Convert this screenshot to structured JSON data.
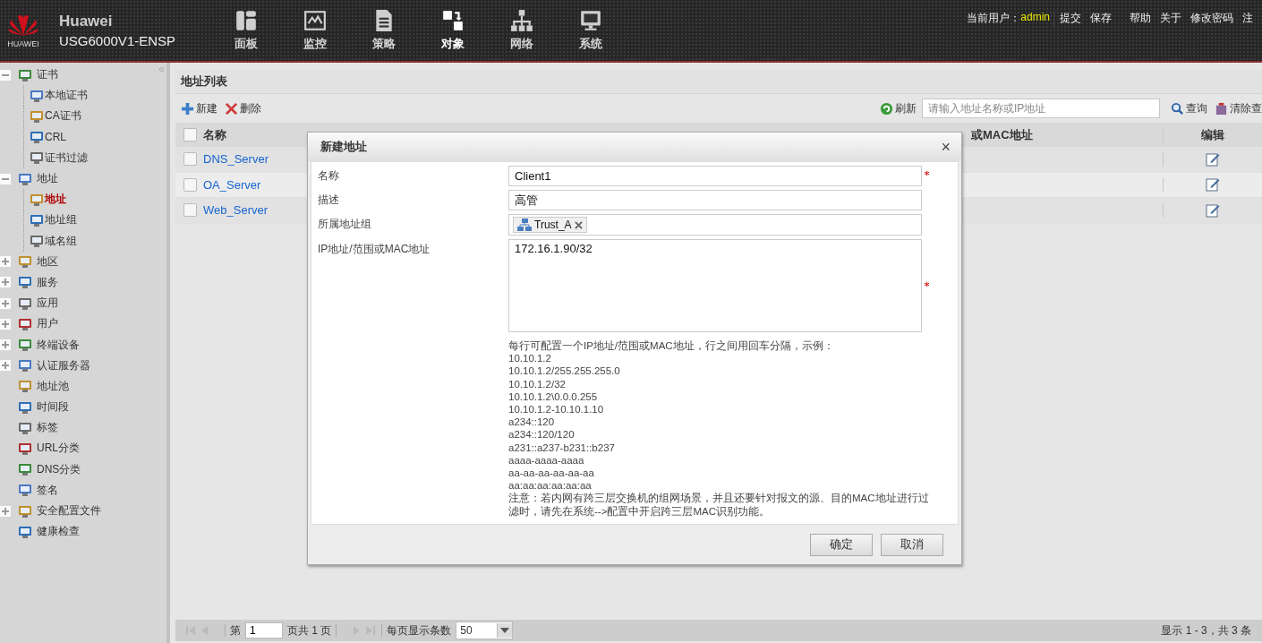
{
  "header": {
    "brand": "HUAWEI",
    "product": "Huawei",
    "model": "USG6000V1-ENSP",
    "nav": [
      {
        "label": "面板",
        "selected": false
      },
      {
        "label": "监控",
        "selected": false
      },
      {
        "label": "策略",
        "selected": false
      },
      {
        "label": "对象",
        "selected": true
      },
      {
        "label": "网络",
        "selected": false
      },
      {
        "label": "系统",
        "selected": false
      }
    ],
    "user_label": "当前用户：",
    "user": "admin",
    "links": [
      "提交",
      "保存",
      "帮助",
      "关于",
      "修改密码",
      "注"
    ]
  },
  "sidebar": {
    "collapse": "«",
    "items": [
      {
        "label": "证书",
        "kind": "folder",
        "expanded": true,
        "selected": false,
        "children": [
          {
            "label": "本地证书",
            "selected": false
          },
          {
            "label": "CA证书",
            "selected": false
          },
          {
            "label": "CRL",
            "selected": false
          },
          {
            "label": "证书过滤",
            "selected": false
          }
        ]
      },
      {
        "label": "地址",
        "kind": "folder",
        "expanded": true,
        "selected": false,
        "children": [
          {
            "label": "地址",
            "selected": true
          },
          {
            "label": "地址组",
            "selected": false
          },
          {
            "label": "域名组",
            "selected": false
          }
        ]
      },
      {
        "label": "地区",
        "kind": "folder",
        "expanded": false,
        "selected": false
      },
      {
        "label": "服务",
        "kind": "folder",
        "expanded": false,
        "selected": false
      },
      {
        "label": "应用",
        "kind": "folder",
        "expanded": false,
        "selected": false
      },
      {
        "label": "用户",
        "kind": "folder",
        "expanded": false,
        "selected": false
      },
      {
        "label": "终端设备",
        "kind": "folder",
        "expanded": false,
        "selected": false
      },
      {
        "label": "认证服务器",
        "kind": "folder",
        "expanded": false,
        "selected": false
      },
      {
        "label": "地址池",
        "kind": "leaf",
        "selected": false
      },
      {
        "label": "时间段",
        "kind": "leaf",
        "selected": false
      },
      {
        "label": "标签",
        "kind": "leaf",
        "selected": false
      },
      {
        "label": "URL分类",
        "kind": "leaf",
        "selected": false
      },
      {
        "label": "DNS分类",
        "kind": "leaf",
        "selected": false
      },
      {
        "label": "签名",
        "kind": "leaf",
        "selected": false
      },
      {
        "label": "安全配置文件",
        "kind": "folder",
        "expanded": false,
        "selected": false
      },
      {
        "label": "健康检查",
        "kind": "leaf",
        "selected": false
      }
    ]
  },
  "panel": {
    "title": "地址列表",
    "new": "新建",
    "delete": "删除",
    "refresh": "刷新",
    "search_placeholder": "请输入地址名称或IP地址",
    "query": "查询",
    "clear": "清除查",
    "table": {
      "all_checked": false,
      "columns": [
        "名称",
        "或MAC地址",
        "编辑"
      ],
      "rows": [
        {
          "name": "DNS_Server",
          "checked": false
        },
        {
          "name": "OA_Server",
          "checked": false
        },
        {
          "name": "Web_Server",
          "checked": false
        }
      ]
    },
    "pager": {
      "page_prefix": "第",
      "page": "1",
      "page_suffix": "页共 1 页",
      "per_page_label": "每页显示条数",
      "per_page": "50",
      "summary": "显示 1 - 3，共 3 条"
    }
  },
  "dialog": {
    "title": "新建地址",
    "close": "×",
    "fields": [
      {
        "label": "名称",
        "kind": "text",
        "value": "Client1",
        "required": true
      },
      {
        "label": "描述",
        "kind": "text",
        "value": "高管",
        "required": false
      },
      {
        "label": "所属地址组",
        "kind": "tags",
        "tags": [
          "Trust_A"
        ],
        "required": false
      },
      {
        "label": "IP地址/范围或MAC地址",
        "kind": "textarea",
        "value": "172.16.1.90/32",
        "required": true
      }
    ],
    "hint": [
      "每行可配置一个IP地址/范围或MAC地址，行之间用回车分隔，示例：",
      "10.10.1.2",
      "10.10.1.2/255.255.255.0",
      "10.10.1.2/32",
      "10.10.1.2\\0.0.0.255",
      "10.10.1.2-10.10.1.10",
      "a234::120",
      "a234::120/120",
      "a231::a237-b231::b237",
      "aaaa-aaaa-aaaa",
      "aa-aa-aa-aa-aa-aa",
      "aa:aa:aa:aa:aa:aa",
      "注意：若内网有跨三层交换机的组网场景，并且还要针对报文的源、目的MAC地址进行过滤时，请先在系统-->配置中开启跨三层MAC识别功能。"
    ],
    "buttons": [
      "确定",
      "取消"
    ]
  }
}
